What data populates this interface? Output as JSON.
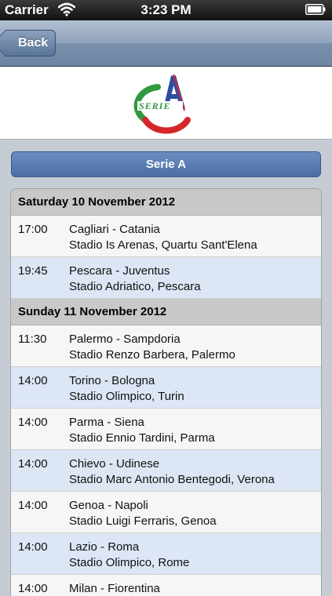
{
  "status_bar": {
    "carrier": "Carrier",
    "time": "3:23 PM",
    "wifi_icon": "wifi-icon",
    "battery_icon": "battery-icon"
  },
  "nav": {
    "back_label": "Back"
  },
  "logo": {
    "icon": "serie-a-logo",
    "colors": {
      "green": "#2e9a3e",
      "red": "#d6262a",
      "blue": "#2b4fa3"
    }
  },
  "title_bar": {
    "label": "Serie A",
    "color": "#4a6fa5"
  },
  "schedule": {
    "days": [
      {
        "date": "Saturday 10 November 2012",
        "matches": [
          {
            "time": "17:00",
            "teams": "Cagliari - Catania",
            "venue": "Stadio Is Arenas, Quartu Sant'Elena"
          },
          {
            "time": "19:45",
            "teams": "Pescara - Juventus",
            "venue": "Stadio Adriatico, Pescara"
          }
        ]
      },
      {
        "date": "Sunday 11 November 2012",
        "matches": [
          {
            "time": "11:30",
            "teams": "Palermo - Sampdoria",
            "venue": "Stadio Renzo Barbera, Palermo"
          },
          {
            "time": "14:00",
            "teams": "Torino - Bologna",
            "venue": "Stadio Olimpico, Turin"
          },
          {
            "time": "14:00",
            "teams": "Parma - Siena",
            "venue": "Stadio Ennio Tardini, Parma"
          },
          {
            "time": "14:00",
            "teams": "Chievo - Udinese",
            "venue": "Stadio Marc Antonio Bentegodi, Verona"
          },
          {
            "time": "14:00",
            "teams": "Genoa - Napoli",
            "venue": "Stadio Luigi Ferraris, Genoa"
          },
          {
            "time": "14:00",
            "teams": "Lazio - Roma",
            "venue": "Stadio Olimpico, Rome"
          },
          {
            "time": "14:00",
            "teams": "Milan - Fiorentina",
            "venue": ""
          }
        ]
      }
    ]
  }
}
